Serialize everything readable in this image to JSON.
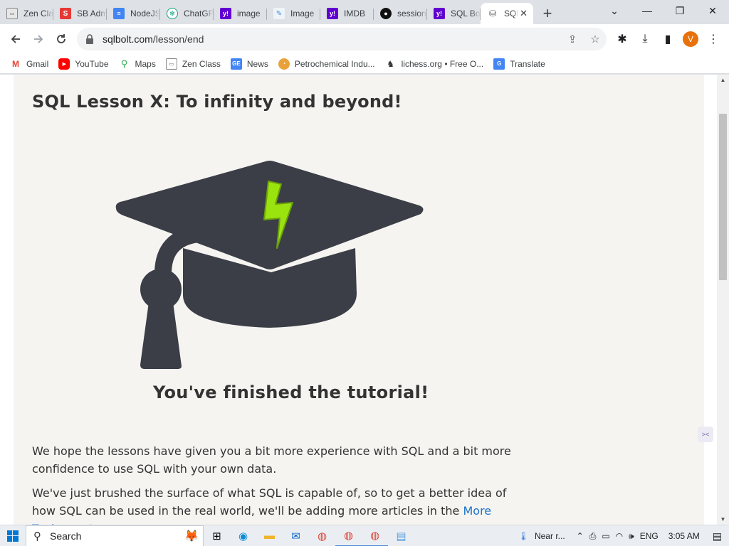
{
  "browser": {
    "tabs": [
      {
        "label": "Zen Class",
        "icon": "zen-class-icon"
      },
      {
        "label": "SB Admin",
        "icon": "sb-admin-icon"
      },
      {
        "label": "NodeJS",
        "icon": "docs-icon"
      },
      {
        "label": "ChatGPT",
        "icon": "chatgpt-icon"
      },
      {
        "label": "image",
        "icon": "yahoo-icon"
      },
      {
        "label": "Image",
        "icon": "image-editor-icon"
      },
      {
        "label": "IMDB",
        "icon": "yahoo-icon"
      },
      {
        "label": "session",
        "icon": "github-icon"
      },
      {
        "label": "SQL Bolt",
        "icon": "yahoo-icon"
      },
      {
        "label": "SQL",
        "icon": "database-icon",
        "active": true
      }
    ],
    "url_host": "sqlbolt.com",
    "url_path": "/lesson/end",
    "profile_initial": "V",
    "bookmarks": [
      {
        "label": "Gmail",
        "icon": "gmail-icon"
      },
      {
        "label": "YouTube",
        "icon": "youtube-icon"
      },
      {
        "label": "Maps",
        "icon": "maps-icon"
      },
      {
        "label": "Zen Class",
        "icon": "zen-class-icon"
      },
      {
        "label": "News",
        "icon": "news-icon"
      },
      {
        "label": "Petrochemical Indu...",
        "icon": "petrochem-icon"
      },
      {
        "label": "lichess.org • Free O...",
        "icon": "lichess-icon"
      },
      {
        "label": "Translate",
        "icon": "translate-icon"
      }
    ]
  },
  "page": {
    "title": "SQL Lesson X: To infinity and beyond!",
    "finished_caption": "You've finished the tutorial!",
    "paragraph1": "We hope the lessons have given you a bit more experience with SQL and a bit more confidence to use SQL with your own data.",
    "paragraph2_before": "We've just brushed the surface of what SQL is capable of, so to get a better idea of how SQL can be used in the real world, we'll be adding more articles in the ",
    "paragraph2_link": "More Topics",
    "paragraph2_after": " part"
  },
  "taskbar": {
    "search_label": "Search",
    "weather": "Near r...",
    "language": "ENG",
    "time": "3:05 AM"
  },
  "colors": {
    "accent_link": "#1e74c8",
    "cap_dark": "#3b3e47",
    "bolt": "#9be30f"
  }
}
